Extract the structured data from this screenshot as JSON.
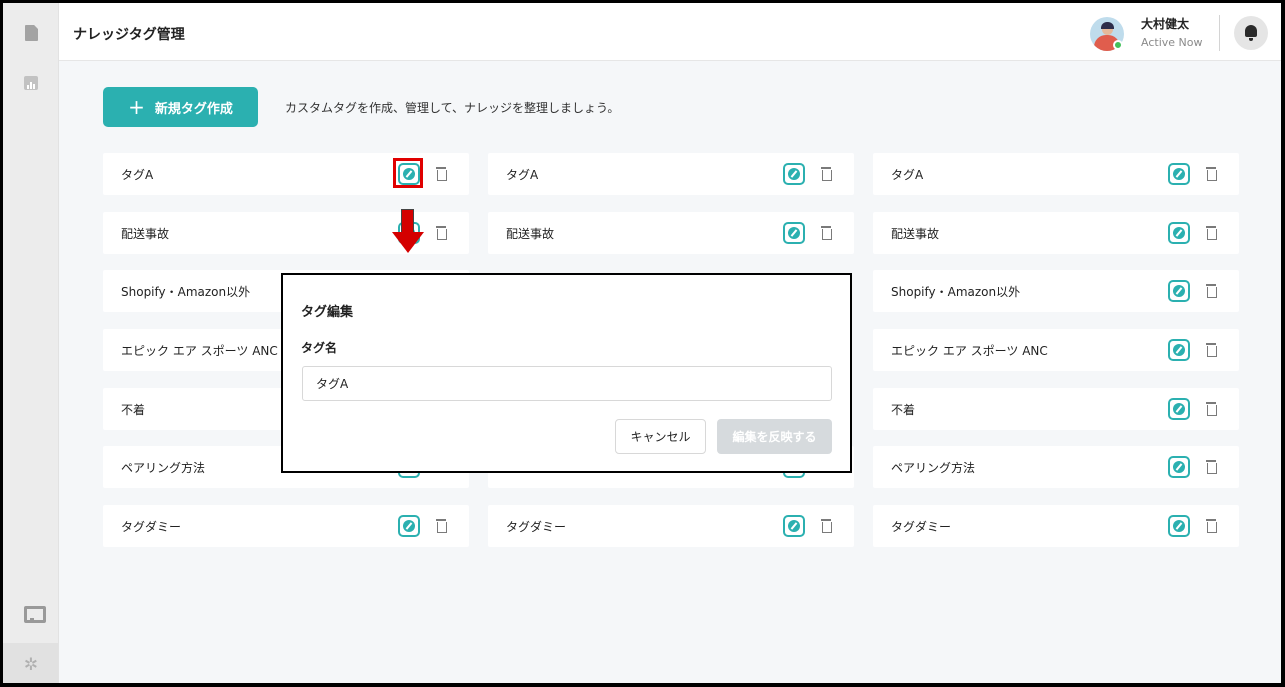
{
  "header": {
    "title": "ナレッジタグ管理",
    "user_name": "大村健太",
    "user_status": "Active Now"
  },
  "toolbar": {
    "new_tag_label": "新規タグ作成",
    "hint": "カスタムタグを作成、管理して、ナレッジを整理しましょう。"
  },
  "tags": {
    "col1": [
      "タグA",
      "配送事故",
      "Shopify・Amazon以外",
      "エピック エア スポーツ ANC",
      "不着",
      "ペアリング方法",
      "タグダミー"
    ],
    "col2": [
      "タグA",
      "配送事故",
      "タグダミー"
    ],
    "col3": [
      "タグA",
      "配送事故",
      "Shopify・Amazon以外",
      "エピック エア スポーツ ANC",
      "不着",
      "ペアリング方法",
      "タグダミー"
    ]
  },
  "modal": {
    "title": "タグ編集",
    "field_label": "タグ名",
    "input_value": "タグA",
    "cancel_label": "キャンセル",
    "apply_label": "編集を反映する"
  },
  "colors": {
    "accent": "#2bb0b0",
    "highlight": "#e00000",
    "disabled_button": "#d6dadd"
  },
  "icons": [
    "document-icon",
    "chart-icon",
    "monitor-icon",
    "gear-icon",
    "plus-icon",
    "edit-icon",
    "trash-icon",
    "bell-icon"
  ]
}
